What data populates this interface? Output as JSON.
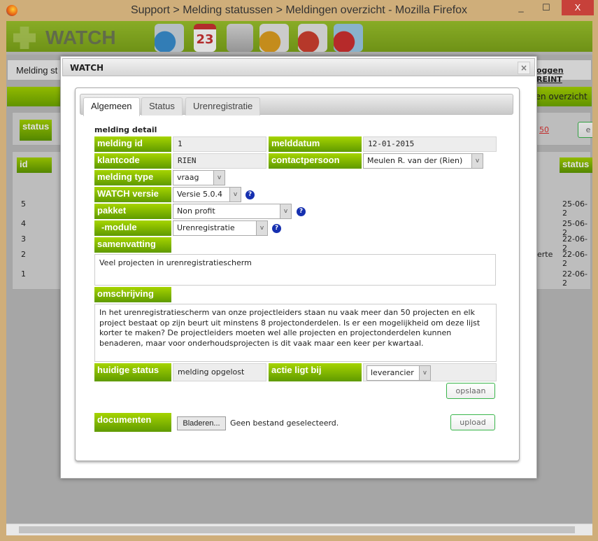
{
  "window": {
    "title": "Support > Melding statussen > Meldingen overzicht - Mozilla Firefox",
    "minimize": "_",
    "maximize": "☐",
    "close": "X"
  },
  "app": {
    "brand": "WATCH",
    "nav_icons": [
      "clock-calendar-icon",
      "calendar-23-icon",
      "users-icon",
      "euro-invoice-icon",
      "phone-support-icon",
      "euro-calculator-icon"
    ],
    "calendar_day": "23"
  },
  "background": {
    "crumb": "Melding st",
    "logout": "oggen REINT",
    "overview_link": "gen overzicht",
    "status_label": "status",
    "page_count": "50",
    "button_e": "e",
    "col_id": "id",
    "col_status": "status",
    "ids": [
      "5",
      "4",
      "3",
      "2",
      "1"
    ],
    "dates": [
      "25-06-2",
      "25-06-2",
      "22-06-2",
      "22-06-2",
      "22-06-2"
    ],
    "erte": "erte"
  },
  "modal": {
    "title": "WATCH",
    "close": "×",
    "tabs": [
      "Algemeen",
      "Status",
      "Urenregistratie"
    ],
    "section": "melding detail",
    "labels": {
      "melding_id": "melding id",
      "melddatum": "melddatum",
      "klantcode": "klantcode",
      "contactpersoon": "contactpersoon",
      "melding_type": "melding type",
      "watch_versie": "WATCH versie",
      "pakket": "pakket",
      "module": "-module",
      "samenvatting": "samenvatting",
      "omschrijving": "omschrijving",
      "huidige_status": "huidige status",
      "actie": "actie ligt bij",
      "documenten": "documenten"
    },
    "values": {
      "melding_id": "1",
      "melddatum": "12-01-2015",
      "klantcode": "RIEN",
      "contactpersoon": "Meulen R. van der (Rien)",
      "melding_type": "vraag",
      "watch_versie": "Versie 5.0.4",
      "pakket": "Non profit",
      "module": "Urenregistratie",
      "samenvatting": "Veel projecten in urenregistratiescherm",
      "omschrijving": "In het urenregistratiescherm van onze projectleiders staan nu vaak meer dan 50 projecten en elk project bestaat op zijn beurt uit minstens 8 projectonderdelen. Is er een mogelijkheid om deze lijst korter te maken? De projectleiders moeten wel alle projecten en projectonderdelen kunnen benaderen, maar voor onderhoudsprojecten is dit vaak maar een keer per  kwartaal.",
      "huidige_status": "melding opgelost",
      "actie": "leverancier"
    },
    "buttons": {
      "opslaan": "opslaan",
      "bladeren": "Bladeren...",
      "upload": "upload"
    },
    "file_status": "Geen bestand geselecteerd.",
    "help": "?",
    "arrow": "v"
  }
}
